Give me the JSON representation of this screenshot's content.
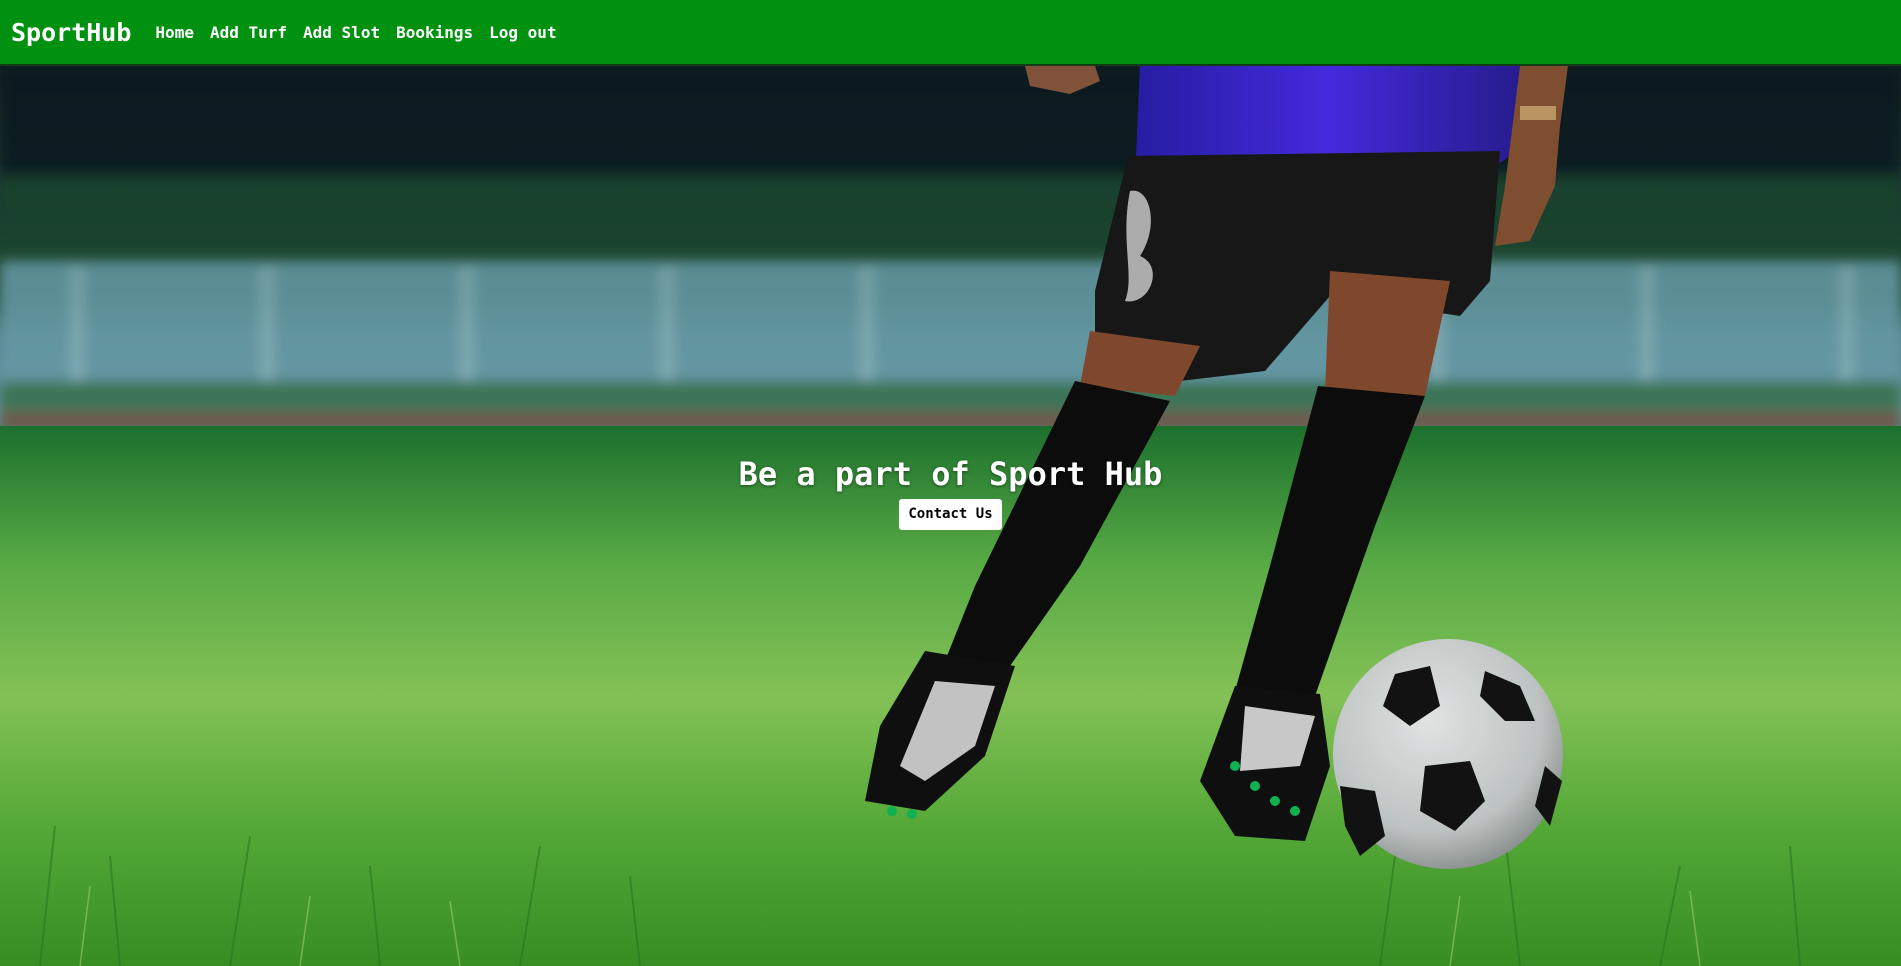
{
  "navbar": {
    "brand": "SportHub",
    "links": [
      {
        "label": "Home"
      },
      {
        "label": "Add Turf"
      },
      {
        "label": "Add Slot"
      },
      {
        "label": "Bookings"
      },
      {
        "label": "Log out"
      }
    ],
    "background_color": "#009111"
  },
  "hero": {
    "image_icon": "soccer-player-dribbling-ball-photo",
    "title": "Be a part of Sport Hub",
    "cta_label": "Contact Us"
  }
}
